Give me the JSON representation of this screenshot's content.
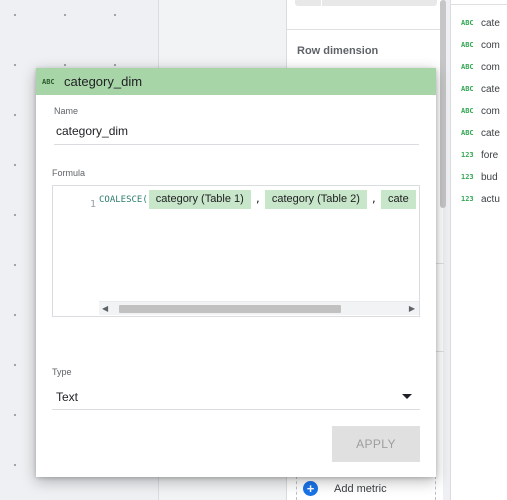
{
  "properties_panel": {
    "section_label": "Row dimension",
    "add_metric_label": "Add metric",
    "add_icon_glyph": "+"
  },
  "data_panel": {
    "fields": [
      {
        "type": "ABC",
        "name": "cate"
      },
      {
        "type": "ABC",
        "name": "com"
      },
      {
        "type": "ABC",
        "name": "com"
      },
      {
        "type": "ABC",
        "name": "cate"
      },
      {
        "type": "ABC",
        "name": "com"
      },
      {
        "type": "ABC",
        "name": "cate"
      },
      {
        "type": "123",
        "name": "fore"
      },
      {
        "type": "123",
        "name": "bud"
      },
      {
        "type": "123",
        "name": "actu"
      }
    ]
  },
  "dialog": {
    "header": {
      "type_badge": "ABC",
      "title": "category_dim",
      "color": "#a8d5a8"
    },
    "name": {
      "label": "Name",
      "value": "category_dim"
    },
    "formula": {
      "label": "Formula",
      "line_number": "1",
      "function": "COALESCE(",
      "args": [
        "category (Table 1)",
        "category (Table 2)",
        "cate"
      ],
      "separator": ","
    },
    "type": {
      "label": "Type",
      "value": "Text"
    },
    "apply_label": "APPLY"
  }
}
